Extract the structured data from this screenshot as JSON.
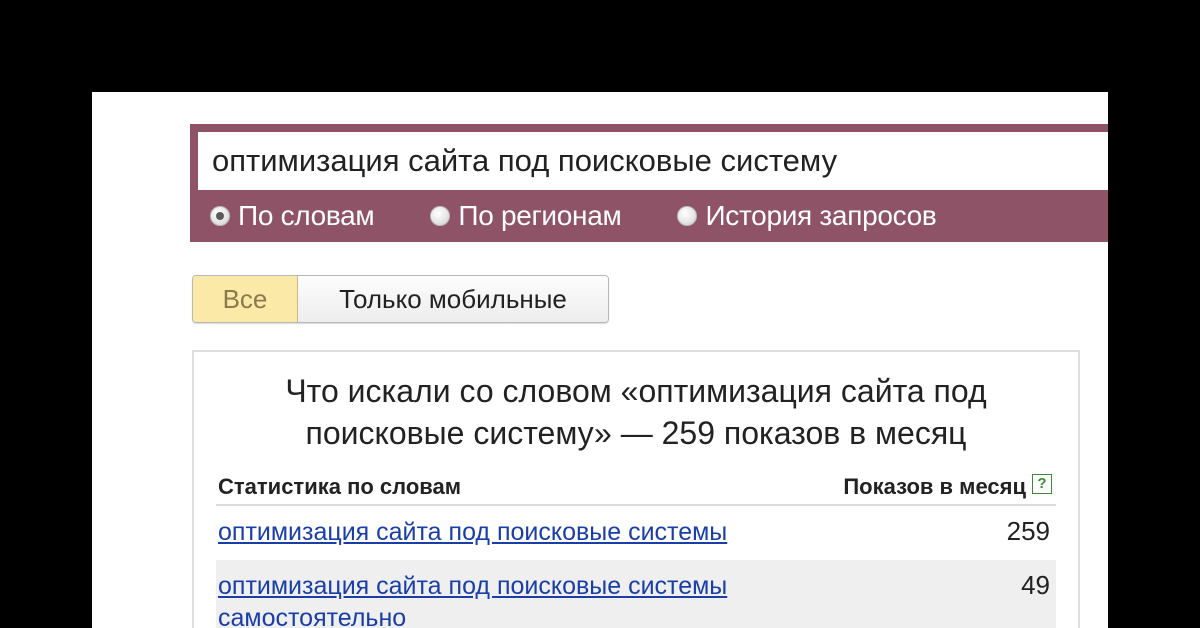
{
  "search": {
    "query": "оптимизация сайта под поисковые систему",
    "modes": [
      {
        "label": "По словам",
        "checked": true
      },
      {
        "label": "По регионам",
        "checked": false
      },
      {
        "label": "История запросов",
        "checked": false
      }
    ]
  },
  "device_filter": {
    "all_label": "Все",
    "mobile_label": "Только мобильные"
  },
  "results": {
    "title_line1": "Что искали со словом «оптимизация сайта под",
    "title_line2": "поисковые систему» — 259 показов в месяц",
    "col_words": "Статистика по словам",
    "col_count": "Показов в месяц",
    "help_glyph": "?",
    "rows": [
      {
        "query": "оптимизация сайта под поисковые системы",
        "count": "259"
      },
      {
        "query": "оптимизация сайта под поисковые системы самостоятельно",
        "count": "49"
      }
    ]
  },
  "colors": {
    "panel": "#8e5366",
    "active_tab": "#fbe9a8",
    "link": "#1a3ea8",
    "help_icon": "#3a8a3a"
  },
  "icons": {
    "help": "question-square-icon"
  }
}
